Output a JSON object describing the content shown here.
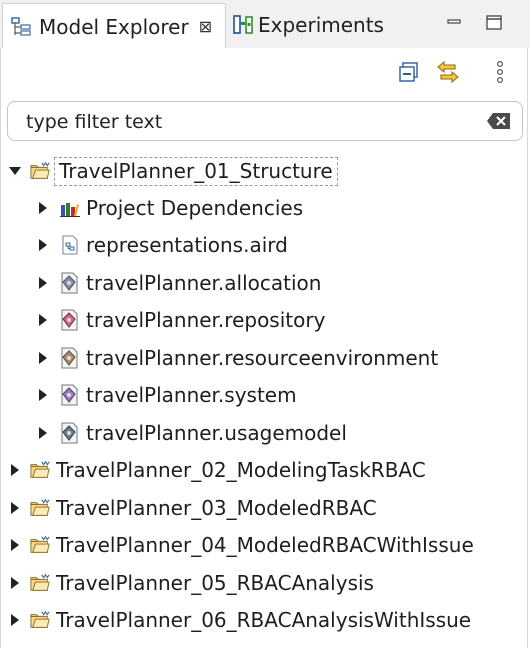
{
  "tabs": [
    {
      "label": "Model Explorer",
      "close_symbol": "⊠",
      "icon": "model-explorer-icon"
    },
    {
      "label": "Experiments",
      "icon": "experiments-icon"
    }
  ],
  "window_controls": {
    "minimize": "minimize-icon",
    "maximize": "maximize-icon"
  },
  "toolbar": {
    "collapse_all": "collapse-all-icon",
    "link_with_editor": "link-with-editor-icon",
    "view_menu": "view-menu-icon"
  },
  "filter": {
    "placeholder": "type filter text",
    "value": ""
  },
  "tree": {
    "root": {
      "label": "TravelPlanner_01_Structure",
      "expanded": true
    },
    "children": [
      {
        "label": "Project Dependencies",
        "icon": "library-icon"
      },
      {
        "label": "representations.aird",
        "icon": "aird-file-icon"
      },
      {
        "label": "travelPlanner.allocation",
        "icon": "pcm-model-icon"
      },
      {
        "label": "travelPlanner.repository",
        "icon": "pcm-model-icon"
      },
      {
        "label": "travelPlanner.resourceenvironment",
        "icon": "pcm-model-icon"
      },
      {
        "label": "travelPlanner.system",
        "icon": "pcm-model-icon"
      },
      {
        "label": "travelPlanner.usagemodel",
        "icon": "pcm-model-icon"
      }
    ],
    "other_projects": [
      {
        "label": "TravelPlanner_02_ModelingTaskRBAC"
      },
      {
        "label": "TravelPlanner_03_ModeledRBAC"
      },
      {
        "label": "TravelPlanner_04_ModeledRBACWithIssue"
      },
      {
        "label": "TravelPlanner_05_RBACAnalysis"
      },
      {
        "label": "TravelPlanner_06_RBACAnalysisWithIssue"
      }
    ]
  }
}
